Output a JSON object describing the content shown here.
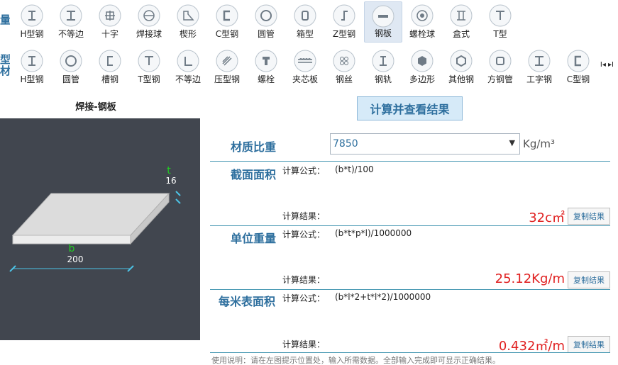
{
  "toolbar": {
    "row1_label": "量",
    "row2_label": "型材",
    "row1": [
      {
        "label": "H型钢",
        "icon": "h-beam-icon"
      },
      {
        "label": "不等边",
        "icon": "i-beam-icon"
      },
      {
        "label": "十字",
        "icon": "cross-icon"
      },
      {
        "label": "焊接球",
        "icon": "welded-ball-icon"
      },
      {
        "label": "楔形",
        "icon": "wedge-icon"
      },
      {
        "label": "C型钢",
        "icon": "c-channel-icon"
      },
      {
        "label": "圆管",
        "icon": "round-tube-icon"
      },
      {
        "label": "箱型",
        "icon": "box-section-icon"
      },
      {
        "label": "Z型钢",
        "icon": "z-section-icon"
      },
      {
        "label": "钢板",
        "icon": "plate-icon",
        "selected": true
      },
      {
        "label": "螺栓球",
        "icon": "bolt-ball-icon"
      },
      {
        "label": "盒式",
        "icon": "box-type-icon"
      },
      {
        "label": "T型",
        "icon": "t-section-icon"
      }
    ],
    "row2": [
      {
        "label": "H型钢",
        "icon": "h-beam-icon"
      },
      {
        "label": "圆管",
        "icon": "round-tube-icon"
      },
      {
        "label": "槽钢",
        "icon": "channel-icon"
      },
      {
        "label": "T型钢",
        "icon": "t-section-icon"
      },
      {
        "label": "不等边",
        "icon": "angle-icon"
      },
      {
        "label": "压型钢",
        "icon": "profiled-sheet-icon"
      },
      {
        "label": "螺栓",
        "icon": "bolt-icon"
      },
      {
        "label": "夹芯板",
        "icon": "sandwich-panel-icon"
      },
      {
        "label": "钢丝",
        "icon": "steel-wire-icon"
      },
      {
        "label": "钢轨",
        "icon": "rail-icon"
      },
      {
        "label": "多边形",
        "icon": "polygon-icon"
      },
      {
        "label": "其他钢",
        "icon": "other-steel-icon"
      },
      {
        "label": "方钢管",
        "icon": "square-tube-icon"
      },
      {
        "label": "工字钢",
        "icon": "i-beam-icon"
      },
      {
        "label": "C型钢",
        "icon": "c-channel-icon"
      }
    ],
    "scroll_arrows": "I◂ ▸I"
  },
  "left": {
    "title": "焊接-钢板",
    "diagram": {
      "t_label": "t",
      "t_value": "16",
      "b_label": "b",
      "b_value": "200"
    }
  },
  "calc_button": "计算并查看结果",
  "density": {
    "label": "材质比重",
    "value": "7850",
    "unit": "Kg/m³"
  },
  "formula_prefix": "计算公式：",
  "result_prefix": "计算结果：",
  "copy_label": "复制结果",
  "sections": [
    {
      "label": "截面面积",
      "formula": "(b*t)/100",
      "result": "32c㎡"
    },
    {
      "label": "单位重量",
      "formula": "(b*t*p*l)/1000000",
      "result": "25.12Kg/m"
    },
    {
      "label": "每米表面积",
      "formula": "(b*l*2+t*l*2)/1000000",
      "result": "0.432㎡/m"
    }
  ],
  "footer": "使用说明：请在左图提示位置处，输入所需数据。全部输入完成即可显示正确结果。",
  "colors": {
    "accent": "#2e6f9e",
    "result": "#e02020",
    "diagram_bg": "#41464f",
    "divider": "#4a9ab4"
  }
}
